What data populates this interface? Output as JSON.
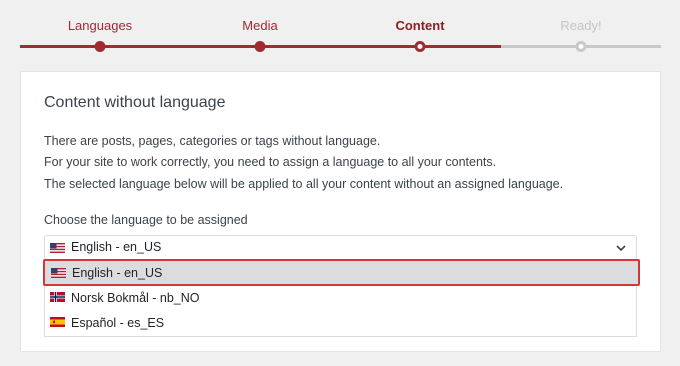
{
  "stepper": {
    "steps": [
      {
        "label": "Languages",
        "state": "done"
      },
      {
        "label": "Media",
        "state": "done"
      },
      {
        "label": "Content",
        "state": "current"
      },
      {
        "label": "Ready!",
        "state": "todo"
      }
    ]
  },
  "card": {
    "title": "Content without language",
    "paragraphs": [
      "There are posts, pages, categories or tags without language.",
      "For your site to work correctly, you need to assign a language to all your contents.",
      "The selected language below will be applied to all your content without an assigned language."
    ],
    "select_label": "Choose the language to be assigned",
    "select": {
      "selected": "English - en_US",
      "selected_flag": "us-flag-icon",
      "options": [
        {
          "label": "English - en_US",
          "flag": "us-flag-icon"
        },
        {
          "label": "Norsk Bokmål - nb_NO",
          "flag": "norway-flag-icon"
        },
        {
          "label": "Español - es_ES",
          "flag": "spain-flag-icon"
        }
      ]
    }
  },
  "colors": {
    "accent": "#a12b31",
    "highlight_border": "#d63638",
    "highlight_bg": "#dcdcde",
    "inactive": "#c8c8c8"
  }
}
